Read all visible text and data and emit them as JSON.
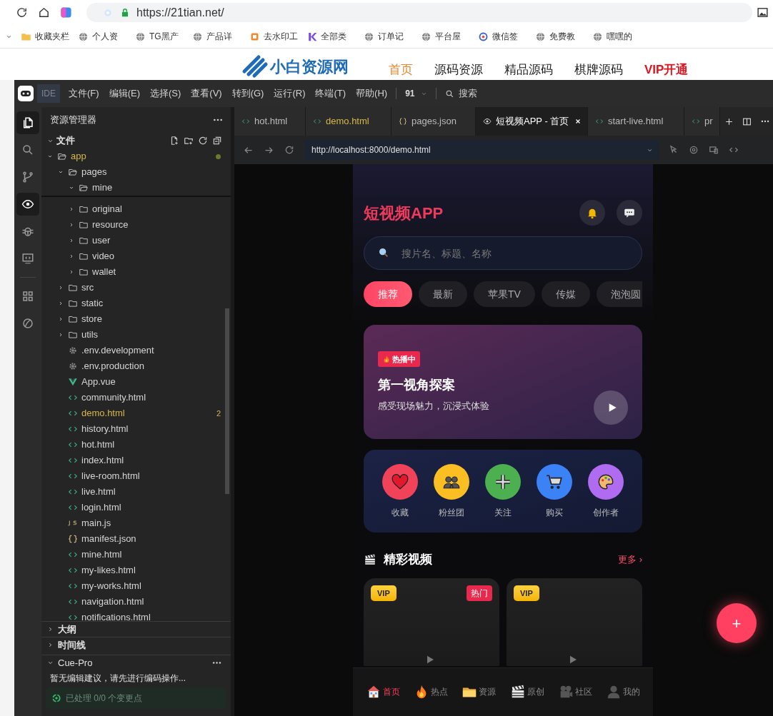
{
  "browser": {
    "address": "https://21tian.net/",
    "bookmarks": [
      {
        "label": "收藏夹栏",
        "kind": "folder"
      },
      {
        "label": "个人资",
        "kind": "globe"
      },
      {
        "label": "TG黑产",
        "kind": "globe"
      },
      {
        "label": "产品详",
        "kind": "globe"
      },
      {
        "label": "去水印工",
        "kind": "stamp"
      },
      {
        "label": "全部类",
        "kind": "k"
      },
      {
        "label": "订单记",
        "kind": "globe"
      },
      {
        "label": "平台屋",
        "kind": "globe"
      },
      {
        "label": "微信签",
        "kind": "ring"
      },
      {
        "label": "免费教",
        "kind": "globe"
      },
      {
        "label": "嘿嘿的",
        "kind": "globe"
      }
    ]
  },
  "website": {
    "logo": "小白资源网",
    "nav": [
      {
        "label": "首页",
        "selected": true,
        "kind": "link"
      },
      {
        "label": "源码资源",
        "selected": false,
        "kind": "link"
      },
      {
        "label": "精品源码",
        "selected": false,
        "kind": "link"
      },
      {
        "label": "棋牌源码",
        "selected": false,
        "kind": "link"
      },
      {
        "label": "VIP开通",
        "selected": false,
        "kind": "vip"
      }
    ]
  },
  "ide": {
    "badge": "IDE",
    "menu": [
      "文件(F)",
      "编辑(E)",
      "选择(S)",
      "查看(V)",
      "转到(G)",
      "运行(R)",
      "终端(T)",
      "帮助(H)"
    ],
    "workspace": "91",
    "search": "搜索",
    "activity": [
      {
        "selected": true
      },
      {
        "selected": false
      },
      {
        "selected": false
      },
      {
        "selected": true
      },
      {
        "selected": false
      },
      {
        "selected": false
      },
      {
        "selected": false
      },
      {
        "selected": false
      }
    ]
  },
  "explorer": {
    "title": "资源管理器",
    "section": "文件",
    "tree": [
      {
        "name": "app",
        "kind": "folder",
        "expanded": true,
        "modified": true,
        "children": [
          {
            "name": "pages",
            "kind": "folder",
            "expanded": true,
            "modified": false,
            "children": [
              {
                "name": "mine",
                "kind": "folder",
                "expanded": true,
                "modified": false
              },
              {
                "name": "original",
                "kind": "folder",
                "expanded": false,
                "modified": false
              },
              {
                "name": "resource",
                "kind": "folder",
                "expanded": false,
                "modified": false
              },
              {
                "name": "user",
                "kind": "folder",
                "expanded": false,
                "modified": false
              },
              {
                "name": "video",
                "kind": "folder",
                "expanded": false,
                "modified": false
              },
              {
                "name": "wallet",
                "kind": "folder",
                "expanded": false,
                "modified": false
              }
            ]
          },
          {
            "name": "src",
            "kind": "folder",
            "expanded": false,
            "modified": false
          },
          {
            "name": "static",
            "kind": "folder",
            "expanded": false,
            "modified": false
          },
          {
            "name": "store",
            "kind": "folder",
            "expanded": false,
            "modified": false
          },
          {
            "name": "utils",
            "kind": "folder",
            "expanded": false,
            "modified": false
          },
          {
            "name": ".env.development",
            "kind": "config",
            "modified": false
          },
          {
            "name": ".env.production",
            "kind": "config",
            "modified": false
          },
          {
            "name": "App.vue",
            "kind": "vue",
            "modified": false
          },
          {
            "name": "community.html",
            "kind": "html",
            "modified": false
          },
          {
            "name": "demo.html",
            "kind": "html",
            "modified": true,
            "badge": "2"
          },
          {
            "name": "history.html",
            "kind": "html",
            "modified": false
          },
          {
            "name": "hot.html",
            "kind": "html",
            "modified": false
          },
          {
            "name": "index.html",
            "kind": "html",
            "modified": false
          },
          {
            "name": "live-room.html",
            "kind": "html",
            "modified": false
          },
          {
            "name": "live.html",
            "kind": "html",
            "modified": false
          },
          {
            "name": "login.html",
            "kind": "html",
            "modified": false
          },
          {
            "name": "main.js",
            "kind": "js",
            "modified": false
          },
          {
            "name": "manifest.json",
            "kind": "json",
            "modified": false
          },
          {
            "name": "mine.html",
            "kind": "html",
            "modified": false
          },
          {
            "name": "my-likes.html",
            "kind": "html",
            "modified": false
          },
          {
            "name": "my-works.html",
            "kind": "html",
            "modified": false
          },
          {
            "name": "navigation.html",
            "kind": "html",
            "modified": false
          },
          {
            "name": "notifications.html",
            "kind": "html",
            "modified": false
          }
        ]
      }
    ]
  },
  "panels": [
    {
      "label": "大纲",
      "expanded": false
    },
    {
      "label": "时间线",
      "expanded": false
    },
    {
      "label": "Cue-Pro",
      "expanded": true
    }
  ],
  "cue_pro": {
    "message": "暂无编辑建议，请先进行编码操作...",
    "status": "已处理 0/0 个变更点"
  },
  "tabs": [
    {
      "label": "hot.html",
      "kind": "html",
      "selected": false,
      "modified": false
    },
    {
      "label": "demo.html",
      "kind": "html",
      "selected": false,
      "modified": true
    },
    {
      "label": "pages.json",
      "kind": "json",
      "selected": false,
      "modified": false
    },
    {
      "label": "短视频APP - 首页",
      "kind": "preview",
      "selected": true,
      "modified": false
    },
    {
      "label": "start-live.html",
      "kind": "html",
      "selected": false,
      "modified": false
    },
    {
      "label": "pr",
      "kind": "html",
      "selected": false,
      "modified": false
    }
  ],
  "preview": {
    "url": "http://localhost:8000/demo.html"
  },
  "app": {
    "title": "短视频APP",
    "search": {
      "placeholder": "搜片名、标题、名称"
    },
    "categories": [
      {
        "label": "推荐",
        "selected": true
      },
      {
        "label": "最新",
        "selected": false
      },
      {
        "label": "苹果TV",
        "selected": false
      },
      {
        "label": "传媒",
        "selected": false
      },
      {
        "label": "泡泡圆",
        "selected": false
      }
    ],
    "banner": {
      "badge": "热播中",
      "title": "第一视角探案",
      "subtitle": "感受现场魅力，沉浸式体验"
    },
    "actions": [
      {
        "label": "收藏",
        "color": "#f0435a"
      },
      {
        "label": "粉丝团",
        "color": "#fbbf24"
      },
      {
        "label": "关注",
        "color": "#4caf50"
      },
      {
        "label": "购买",
        "color": "#3b82f6"
      },
      {
        "label": "创作者",
        "color": "#b06cf0"
      }
    ],
    "section": {
      "title": "精彩视频",
      "more": "更多 ›"
    },
    "videos": [
      {
        "vip": "VIP",
        "tag": "热门"
      },
      {
        "vip": "VIP"
      }
    ],
    "nav": [
      {
        "label": "首页",
        "selected": true
      },
      {
        "label": "热点",
        "selected": false
      },
      {
        "label": "资源",
        "selected": false
      },
      {
        "label": "原创",
        "selected": false
      },
      {
        "label": "社区",
        "selected": false
      },
      {
        "label": "我的",
        "selected": false
      }
    ],
    "fab": "+"
  }
}
